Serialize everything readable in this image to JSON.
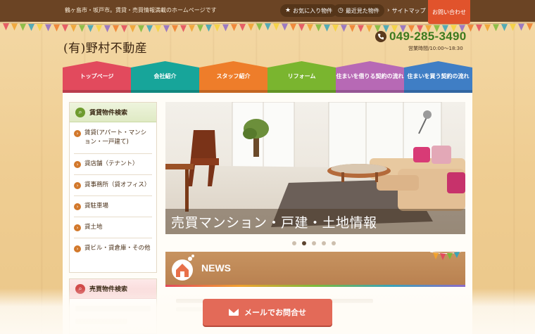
{
  "topbar": {
    "tagline": "鶴ヶ島市・坂戸市。賃貸・売買情報満載のホームページです",
    "favorites": "お気に入り物件",
    "recent": "最近見た物件",
    "sitemap": "サイトマップ",
    "contact": "お問い合わせ"
  },
  "header": {
    "logo": "(有)野村不動産",
    "phone": "049-285-3490",
    "hours": "営業時間/10:00〜18:30"
  },
  "nav": {
    "items": [
      {
        "label": "トップページ",
        "color": "#e24a5d"
      },
      {
        "label": "会社紹介",
        "color": "#17a59a"
      },
      {
        "label": "スタッフ紹介",
        "color": "#ee7d2a"
      },
      {
        "label": "リフォーム",
        "color": "#7ab52f"
      },
      {
        "label": "住まいを借りる契約の流れ",
        "color": "#b769b5"
      },
      {
        "label": "住まいを買う契約の流れ",
        "color": "#3f7ec5"
      }
    ]
  },
  "sidebar": {
    "rent_title": "賃貸物件検索",
    "rent_items": [
      "賃貸(アパート・マンション・一戸建て)",
      "貸店舗（テナント）",
      "貸事務所（貸オフィス）",
      "貸駐車場",
      "貸土地",
      "貸ビル・貸倉庫・その他"
    ],
    "sale_title": "売買物件検索"
  },
  "hero": {
    "caption": "売買マンション・戸建・土地情報",
    "slide_count": 5,
    "active_slide": 2
  },
  "news": {
    "title": "NEWS"
  },
  "mail_button": {
    "label": "メールでお問合せ"
  }
}
